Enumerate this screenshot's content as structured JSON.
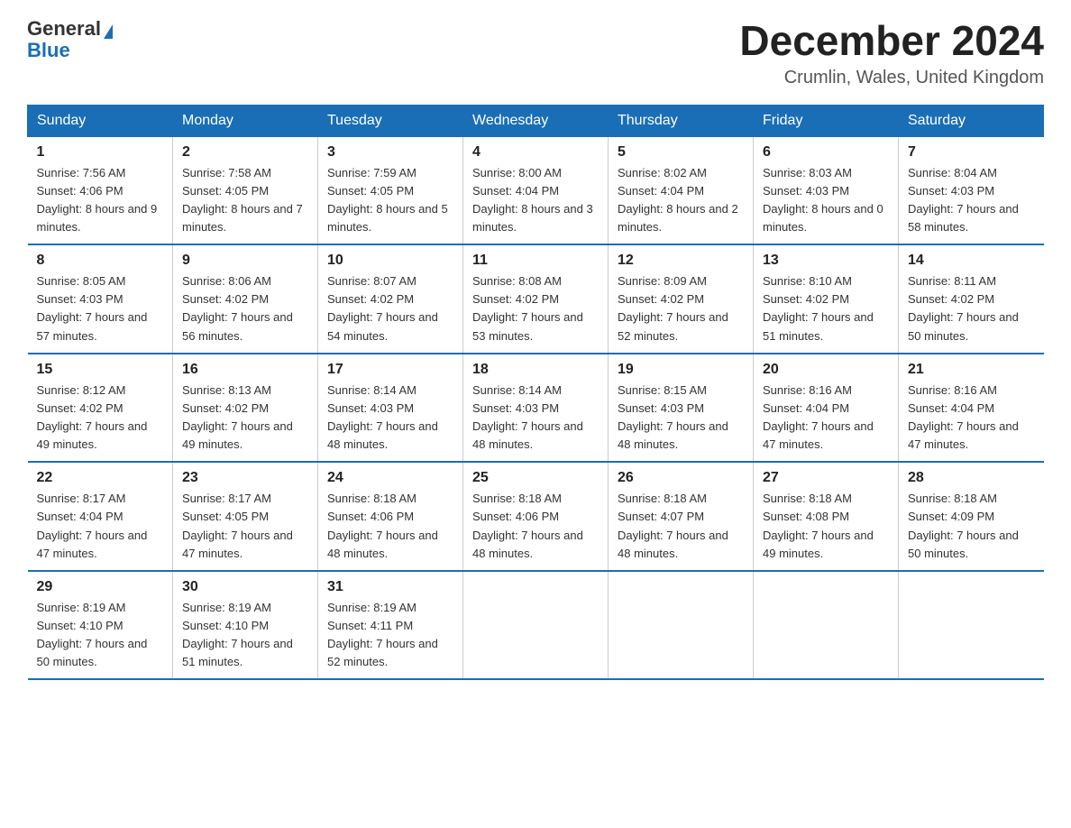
{
  "header": {
    "logo_general": "General",
    "logo_blue": "Blue",
    "month_title": "December 2024",
    "location": "Crumlin, Wales, United Kingdom"
  },
  "days_of_week": [
    "Sunday",
    "Monday",
    "Tuesday",
    "Wednesday",
    "Thursday",
    "Friday",
    "Saturday"
  ],
  "weeks": [
    [
      {
        "day": "1",
        "sunrise": "7:56 AM",
        "sunset": "4:06 PM",
        "daylight": "8 hours and 9 minutes."
      },
      {
        "day": "2",
        "sunrise": "7:58 AM",
        "sunset": "4:05 PM",
        "daylight": "8 hours and 7 minutes."
      },
      {
        "day": "3",
        "sunrise": "7:59 AM",
        "sunset": "4:05 PM",
        "daylight": "8 hours and 5 minutes."
      },
      {
        "day": "4",
        "sunrise": "8:00 AM",
        "sunset": "4:04 PM",
        "daylight": "8 hours and 3 minutes."
      },
      {
        "day": "5",
        "sunrise": "8:02 AM",
        "sunset": "4:04 PM",
        "daylight": "8 hours and 2 minutes."
      },
      {
        "day": "6",
        "sunrise": "8:03 AM",
        "sunset": "4:03 PM",
        "daylight": "8 hours and 0 minutes."
      },
      {
        "day": "7",
        "sunrise": "8:04 AM",
        "sunset": "4:03 PM",
        "daylight": "7 hours and 58 minutes."
      }
    ],
    [
      {
        "day": "8",
        "sunrise": "8:05 AM",
        "sunset": "4:03 PM",
        "daylight": "7 hours and 57 minutes."
      },
      {
        "day": "9",
        "sunrise": "8:06 AM",
        "sunset": "4:02 PM",
        "daylight": "7 hours and 56 minutes."
      },
      {
        "day": "10",
        "sunrise": "8:07 AM",
        "sunset": "4:02 PM",
        "daylight": "7 hours and 54 minutes."
      },
      {
        "day": "11",
        "sunrise": "8:08 AM",
        "sunset": "4:02 PM",
        "daylight": "7 hours and 53 minutes."
      },
      {
        "day": "12",
        "sunrise": "8:09 AM",
        "sunset": "4:02 PM",
        "daylight": "7 hours and 52 minutes."
      },
      {
        "day": "13",
        "sunrise": "8:10 AM",
        "sunset": "4:02 PM",
        "daylight": "7 hours and 51 minutes."
      },
      {
        "day": "14",
        "sunrise": "8:11 AM",
        "sunset": "4:02 PM",
        "daylight": "7 hours and 50 minutes."
      }
    ],
    [
      {
        "day": "15",
        "sunrise": "8:12 AM",
        "sunset": "4:02 PM",
        "daylight": "7 hours and 49 minutes."
      },
      {
        "day": "16",
        "sunrise": "8:13 AM",
        "sunset": "4:02 PM",
        "daylight": "7 hours and 49 minutes."
      },
      {
        "day": "17",
        "sunrise": "8:14 AM",
        "sunset": "4:03 PM",
        "daylight": "7 hours and 48 minutes."
      },
      {
        "day": "18",
        "sunrise": "8:14 AM",
        "sunset": "4:03 PM",
        "daylight": "7 hours and 48 minutes."
      },
      {
        "day": "19",
        "sunrise": "8:15 AM",
        "sunset": "4:03 PM",
        "daylight": "7 hours and 48 minutes."
      },
      {
        "day": "20",
        "sunrise": "8:16 AM",
        "sunset": "4:04 PM",
        "daylight": "7 hours and 47 minutes."
      },
      {
        "day": "21",
        "sunrise": "8:16 AM",
        "sunset": "4:04 PM",
        "daylight": "7 hours and 47 minutes."
      }
    ],
    [
      {
        "day": "22",
        "sunrise": "8:17 AM",
        "sunset": "4:04 PM",
        "daylight": "7 hours and 47 minutes."
      },
      {
        "day": "23",
        "sunrise": "8:17 AM",
        "sunset": "4:05 PM",
        "daylight": "7 hours and 47 minutes."
      },
      {
        "day": "24",
        "sunrise": "8:18 AM",
        "sunset": "4:06 PM",
        "daylight": "7 hours and 48 minutes."
      },
      {
        "day": "25",
        "sunrise": "8:18 AM",
        "sunset": "4:06 PM",
        "daylight": "7 hours and 48 minutes."
      },
      {
        "day": "26",
        "sunrise": "8:18 AM",
        "sunset": "4:07 PM",
        "daylight": "7 hours and 48 minutes."
      },
      {
        "day": "27",
        "sunrise": "8:18 AM",
        "sunset": "4:08 PM",
        "daylight": "7 hours and 49 minutes."
      },
      {
        "day": "28",
        "sunrise": "8:18 AM",
        "sunset": "4:09 PM",
        "daylight": "7 hours and 50 minutes."
      }
    ],
    [
      {
        "day": "29",
        "sunrise": "8:19 AM",
        "sunset": "4:10 PM",
        "daylight": "7 hours and 50 minutes."
      },
      {
        "day": "30",
        "sunrise": "8:19 AM",
        "sunset": "4:10 PM",
        "daylight": "7 hours and 51 minutes."
      },
      {
        "day": "31",
        "sunrise": "8:19 AM",
        "sunset": "4:11 PM",
        "daylight": "7 hours and 52 minutes."
      },
      null,
      null,
      null,
      null
    ]
  ]
}
